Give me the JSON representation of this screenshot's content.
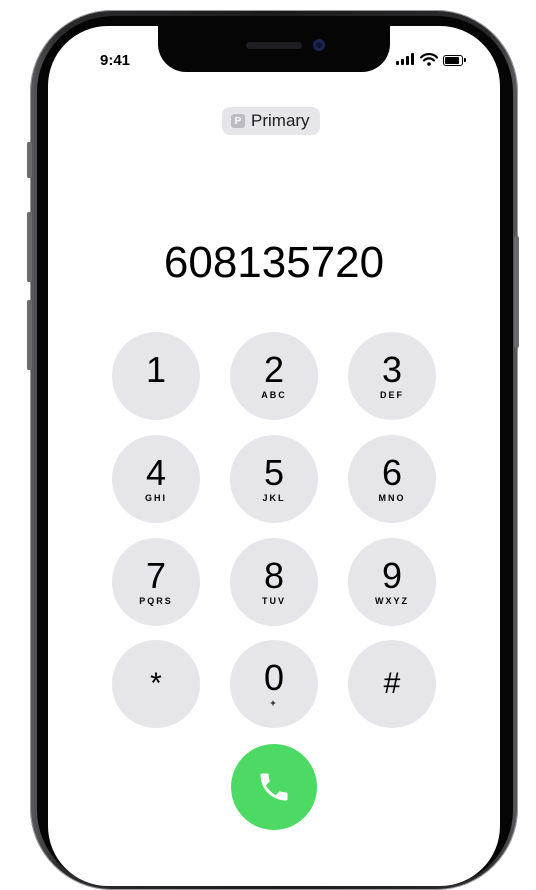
{
  "status_bar": {
    "time": "9:41",
    "signal_bars": 4,
    "wifi_icon": "wifi-icon",
    "battery_level": 0.8
  },
  "line_selector": {
    "badge_letter": "P",
    "label": "Primary"
  },
  "dialed_number": "608135720",
  "keypad": {
    "keys": [
      {
        "digit": "1",
        "letters": ""
      },
      {
        "digit": "2",
        "letters": "ABC"
      },
      {
        "digit": "3",
        "letters": "DEF"
      },
      {
        "digit": "4",
        "letters": "GHI"
      },
      {
        "digit": "5",
        "letters": "JKL"
      },
      {
        "digit": "6",
        "letters": "MNO"
      },
      {
        "digit": "7",
        "letters": "PQRS"
      },
      {
        "digit": "8",
        "letters": "TUV"
      },
      {
        "digit": "9",
        "letters": "WXYZ"
      },
      {
        "digit": "*",
        "letters": ""
      },
      {
        "digit": "0",
        "letters": "+"
      },
      {
        "digit": "#",
        "letters": ""
      }
    ]
  },
  "call_button": {
    "icon": "phone-icon",
    "color": "#4cd964"
  },
  "colors": {
    "key_bg": "#e5e5ea",
    "call_green": "#4cd964",
    "frame": "#1b1b1c"
  }
}
